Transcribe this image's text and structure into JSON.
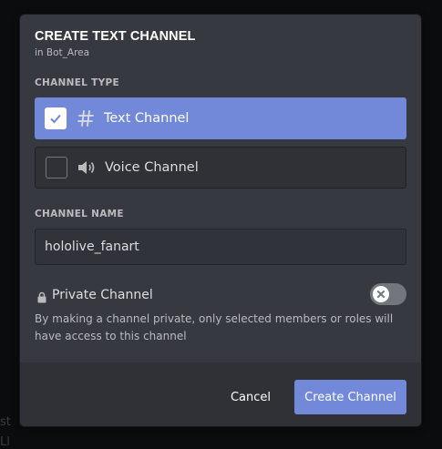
{
  "background": {
    "line1": "st",
    "line2": "Ll"
  },
  "modal": {
    "title": "CREATE TEXT CHANNEL",
    "subtitle": "in Bot_Area",
    "channel_type_label": "CHANNEL TYPE",
    "options": [
      {
        "label": "Text Channel",
        "icon": "hashtag-icon",
        "checked": true
      },
      {
        "label": "Voice Channel",
        "icon": "speaker-icon",
        "checked": false
      }
    ],
    "channel_name_label": "CHANNEL NAME",
    "channel_name_value": "hololive_fanart",
    "private": {
      "label": "Private Channel",
      "enabled": false,
      "description": "By making a channel private, only selected members or roles will have access to this channel"
    },
    "buttons": {
      "cancel": "Cancel",
      "create": "Create Channel"
    }
  },
  "colors": {
    "accent": "#7289da",
    "modal_bg": "#36393f",
    "footer_bg": "#2f3136",
    "toggle_off": "#72767d"
  }
}
